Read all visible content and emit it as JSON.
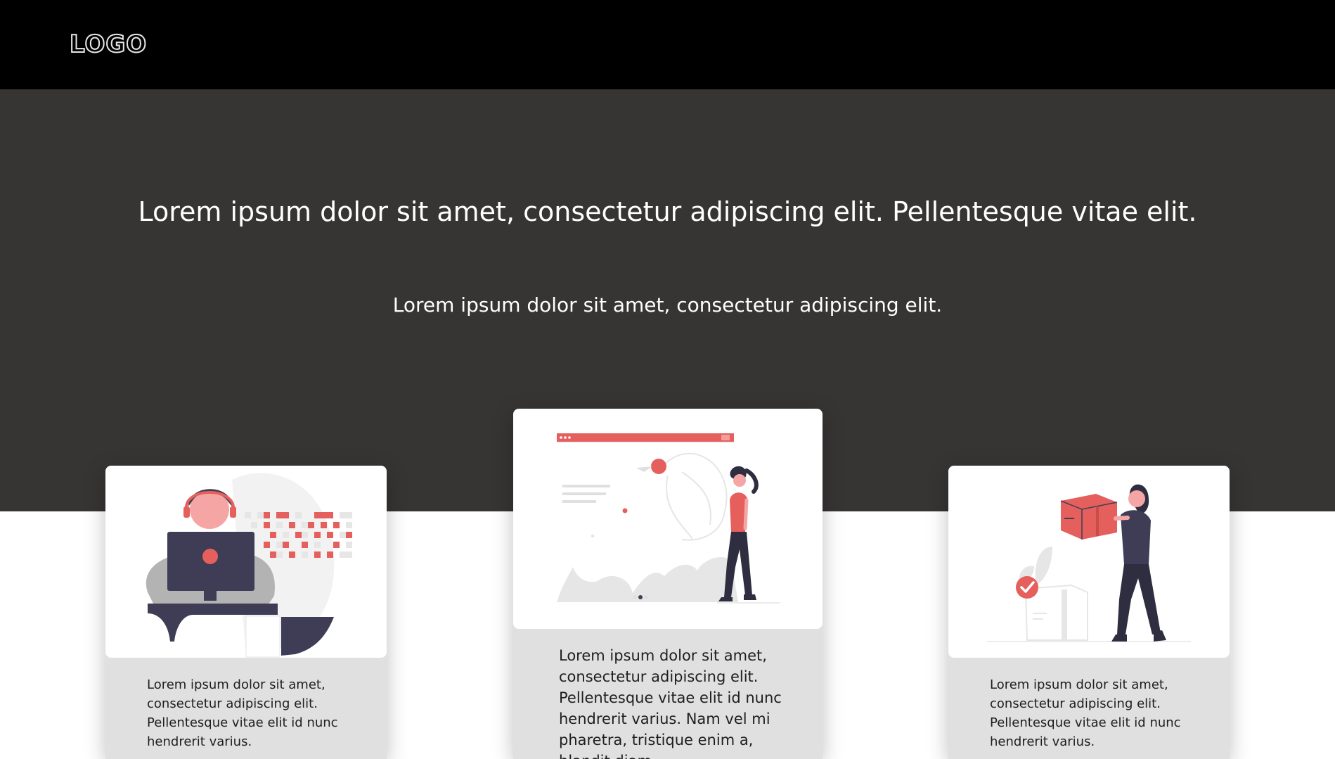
{
  "header": {
    "logo_text": "LOGO"
  },
  "hero": {
    "title": "Lorem ipsum dolor sit amet, consectetur adipiscing elit. Pellentesque vitae elit.",
    "subtitle": "Lorem ipsum dolor sit amet, consectetur adipiscing elit."
  },
  "cards": [
    {
      "illustration": "person-at-computer-illustration",
      "text": "Lorem ipsum dolor sit amet, consectetur adipiscing elit. Pellentesque vitae elit id nunc hendrerit varius."
    },
    {
      "illustration": "woman-browser-window-illustration",
      "text": "Lorem ipsum dolor sit amet, consectetur adipiscing elit. Pellentesque vitae elit id nunc hendrerit varius. Nam vel mi pharetra, tristique enim a, blandit diam."
    },
    {
      "illustration": "woman-carrying-box-illustration",
      "text": "Lorem ipsum dolor sit amet, consectetur adipiscing elit. Pellentesque vitae elit id nunc hendrerit varius."
    }
  ],
  "colors": {
    "header_bg": "#000000",
    "hero_bg": "#373434",
    "accent": "#e5605d",
    "dark_figure": "#3f3d56",
    "card_body": "#e0e0e0"
  }
}
